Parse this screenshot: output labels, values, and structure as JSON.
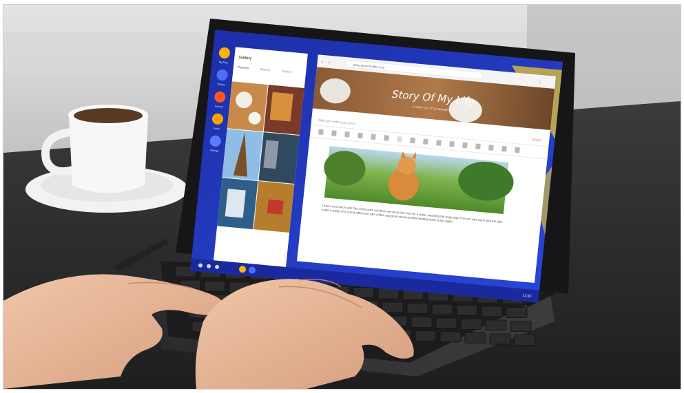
{
  "photo": {
    "subject": "hands-typing-on-tablet-with-keyboard-cover",
    "colors": {
      "wall": "#cfcfcf",
      "table": "#2f2f31",
      "tablet_bezel": "#161618",
      "taskbar_blue": "#1b2fb0",
      "skin": "#e8b899"
    }
  },
  "tablet": {
    "edge_panel": {
      "app_labels": [
        "My Files",
        "Gallery",
        "Internet",
        "Notes",
        "Settings"
      ],
      "icon_colors": [
        "#ffb300",
        "#4f6ef7",
        "#ff5722",
        "#ffa000",
        "#5c7cfa"
      ]
    },
    "gallery_window": {
      "title": "Gallery",
      "tabs": [
        "Pictures",
        "Albums",
        "Stories"
      ]
    },
    "browser_window": {
      "url": "www.storyofmylife.com",
      "header_title": "Story Of My Life",
      "header_subtitle": "A DIARY OF LITTLE MOMENTS",
      "post_title_placeholder": "Title and write your post",
      "post_button": "POST",
      "body_text": "I had a nice lunch with Dex at the park and then we sat by the river for a while, watching the dogs play. The sun was warm and the lake made it perfect for a slow afternoon with coffee and good stories before heading back home again."
    },
    "taskbar": {
      "time": "12:45"
    }
  }
}
